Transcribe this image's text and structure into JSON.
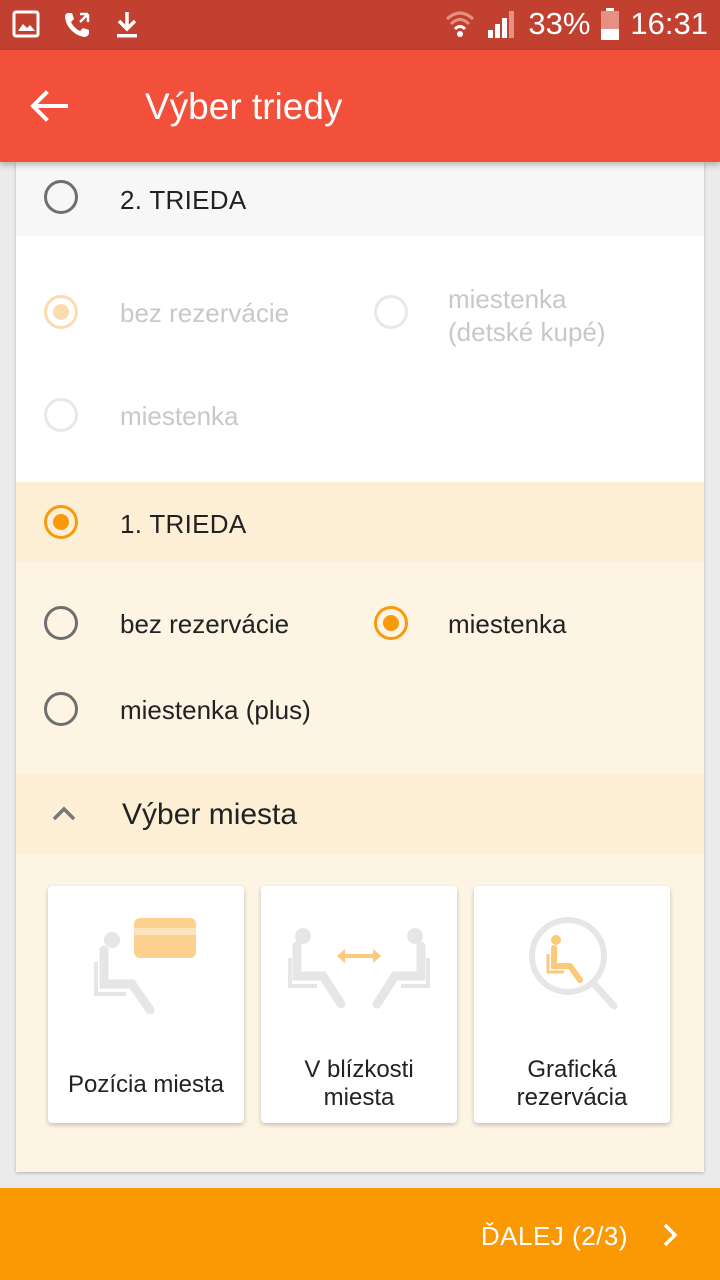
{
  "status_bar": {
    "battery": "33%",
    "time": "16:31"
  },
  "app_bar": {
    "title": "Výber triedy"
  },
  "class2": {
    "label": "2. TRIEDA",
    "options": {
      "bez_rezervacie": "bez rezervácie",
      "miestenka_detske_line1": "miestenka",
      "miestenka_detske_line2": "(detské kupé)",
      "miestenka": "miestenka"
    }
  },
  "class1": {
    "label": "1. TRIEDA",
    "options": {
      "bez_rezervacie": "bez rezervácie",
      "miestenka": "miestenka",
      "miestenka_plus": "miestenka (plus)"
    }
  },
  "seat_choice": {
    "title": "Výber miesta",
    "tiles": {
      "position_line1": "Pozícia miesta",
      "near_line1": "V blízkosti",
      "near_line2": "miesta",
      "graphic_line1": "Grafická",
      "graphic_line2": "rezervácia"
    }
  },
  "footer": {
    "next_label": "ĎALEJ (2/3)"
  },
  "colors": {
    "status_bar": "#c2402f",
    "app_bar": "#f2503a",
    "accent": "#f89a0c",
    "selected_bg": "#fdf4e4",
    "footer": "#fa9904"
  }
}
